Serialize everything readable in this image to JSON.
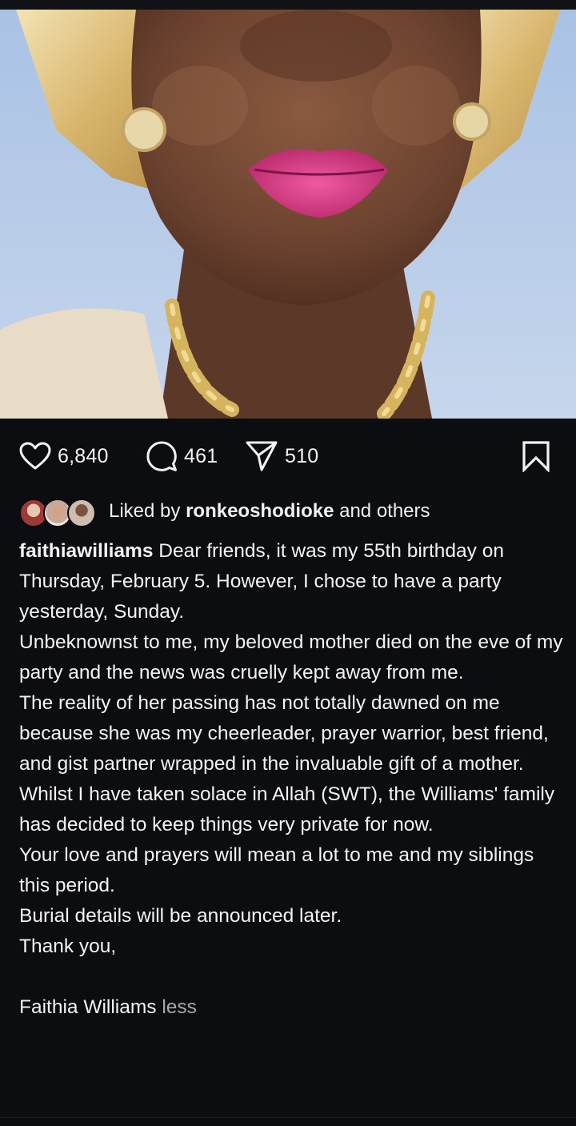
{
  "post": {
    "likes_count": "6,840",
    "comments_count": "461",
    "shares_count": "510",
    "liked_by_prefix": "Liked by",
    "liked_by_user": "ronkeoshodioke",
    "liked_by_suffix": "and others",
    "author": "faithiawilliams",
    "caption_lines": [
      "Dear friends, it was my 55th birthday on Thursday, February 5. However, I chose to have a party yesterday, Sunday.",
      "Unbeknownst to me, my beloved mother died on the eve of my party and the news was cruelly kept away from me.",
      "The reality of her passing has not totally dawned on me because she was my cheerleader, prayer warrior, best friend, and gist partner wrapped in the invaluable gift of a mother.",
      "Whilst I have taken solace in Allah (SWT), the Williams' family has decided to keep things very private for now.",
      "Your love and prayers will mean a lot to me and my siblings this period.",
      "Burial details will be announced later.",
      "Thank you,"
    ],
    "signature": "Faithia Williams",
    "less_label": "less"
  },
  "icons": {
    "like": "heart-outline-icon",
    "comment": "speech-bubble-icon",
    "share": "paper-plane-icon",
    "save": "bookmark-icon"
  },
  "colors": {
    "background": "#0c0d10",
    "text": "#f3f3f3",
    "muted": "#a8a8a8",
    "photo_backdrop": "#b7cbe6"
  }
}
